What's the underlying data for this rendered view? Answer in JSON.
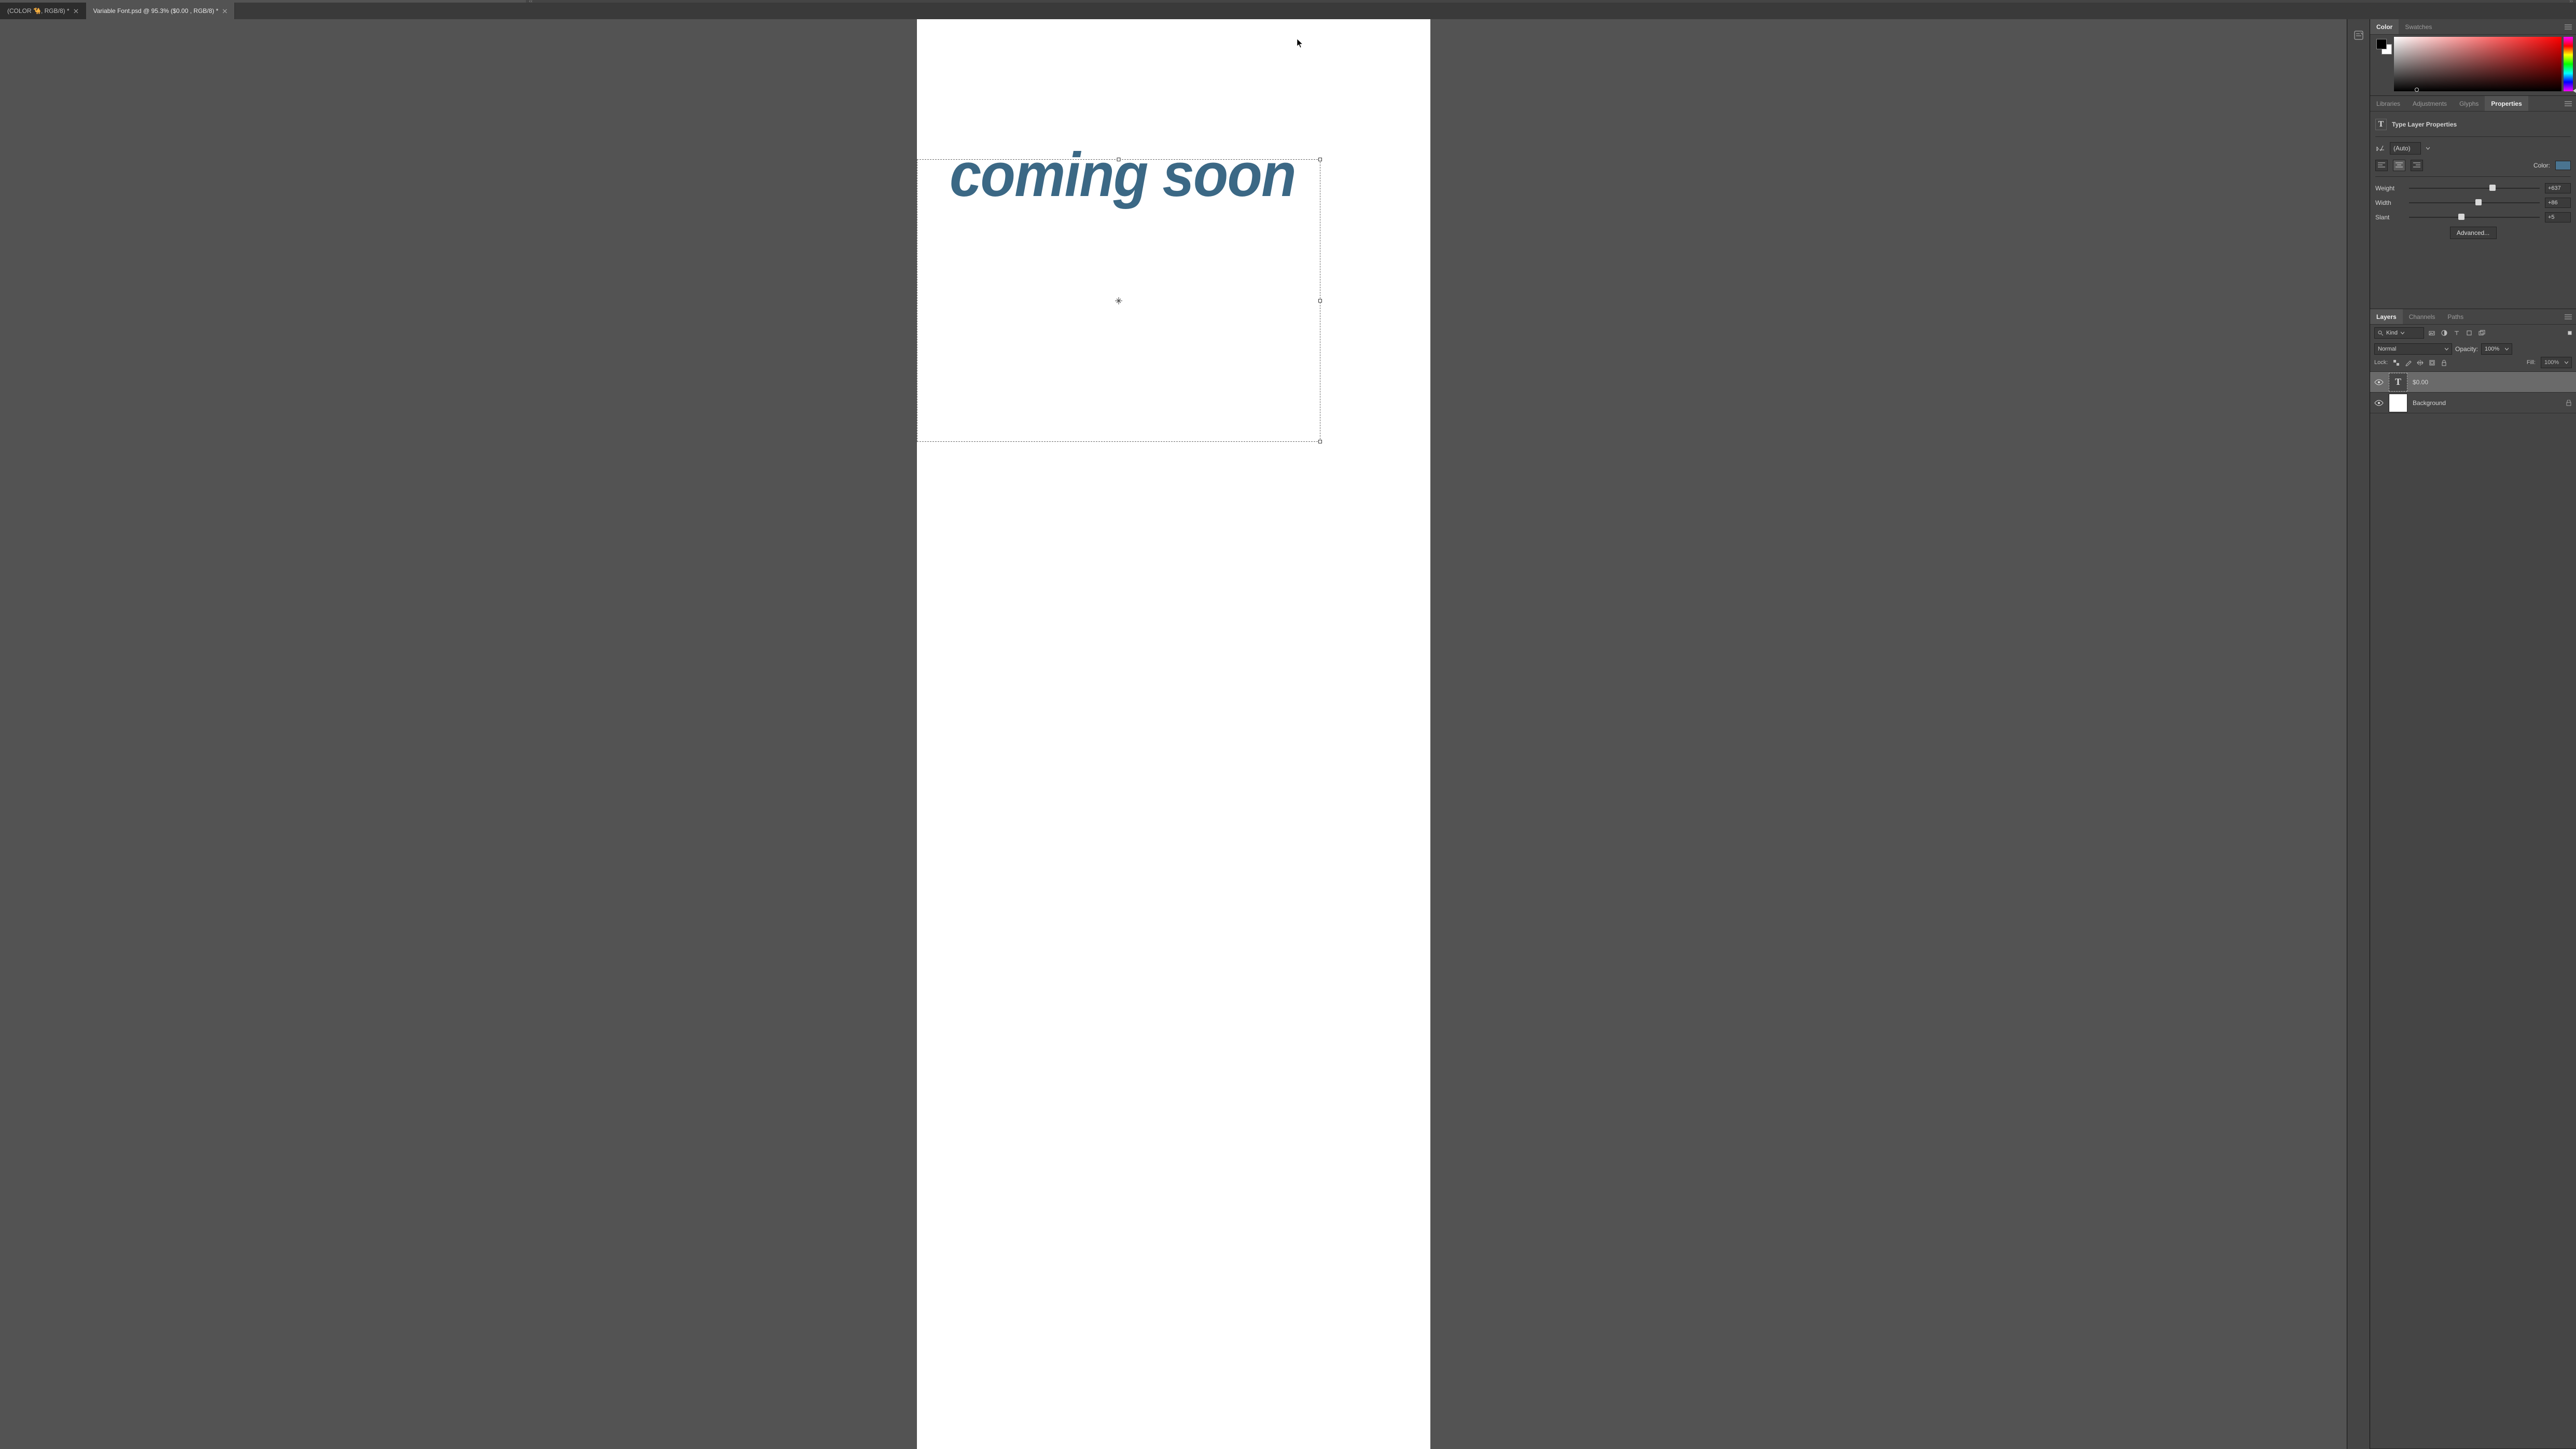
{
  "tabs": [
    {
      "label": "(COLOR 🐪, RGB/8) *"
    },
    {
      "label": "Variable Font.psd @ 95.3% ($0.00    , RGB/8) *"
    }
  ],
  "canvas": {
    "text": "coming soon",
    "text_color": "#3b6885"
  },
  "color_panel": {
    "tabs": [
      "Color",
      "Swatches"
    ],
    "active_tab": "Color",
    "foreground": "#000000",
    "background": "#ffffff"
  },
  "props_panel": {
    "tabs": [
      "Libraries",
      "Adjustments",
      "Glyphs",
      "Properties"
    ],
    "active_tab": "Properties",
    "header": "Type Layer Properties",
    "tracking": "(Auto)",
    "color_label": "Color:",
    "text_color": "#4a7490",
    "sliders": {
      "weight": {
        "label": "Weight",
        "value": "+637",
        "pos": 64
      },
      "width": {
        "label": "Width",
        "value": "+86",
        "pos": 53
      },
      "slant": {
        "label": "Slant",
        "value": "+5",
        "pos": 40
      }
    },
    "advanced": "Advanced..."
  },
  "layers_panel": {
    "tabs": [
      "Layers",
      "Channels",
      "Paths"
    ],
    "active_tab": "Layers",
    "filter_placeholder": "Kind",
    "blend_mode": "Normal",
    "opacity_label": "Opacity:",
    "opacity_value": "100%",
    "lock_label": "Lock:",
    "fill_label": "Fill:",
    "fill_value": "100%",
    "layers": [
      {
        "name": "$0.00",
        "kind": "text",
        "selected": true
      },
      {
        "name": "Background",
        "kind": "bg",
        "locked": true
      }
    ]
  }
}
